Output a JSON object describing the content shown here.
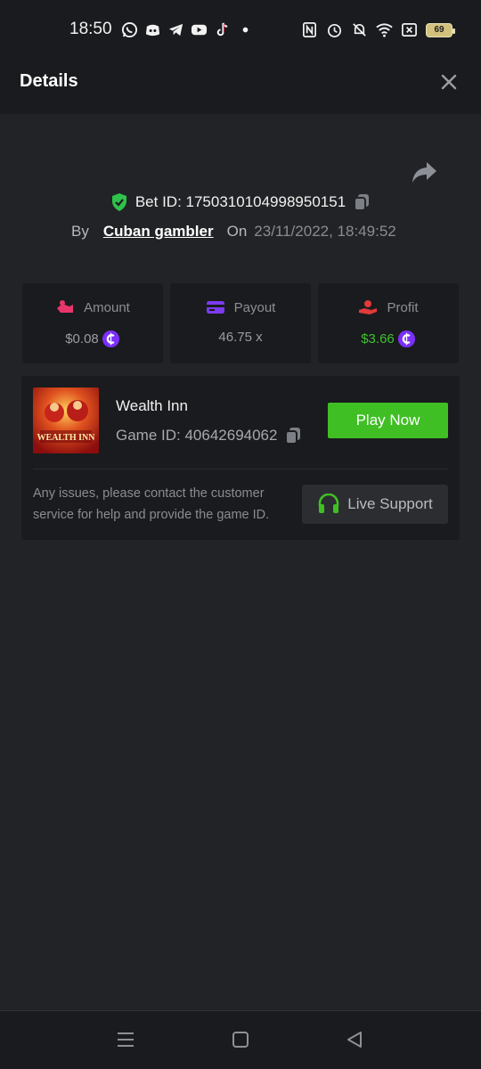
{
  "status_bar": {
    "time": "18:50",
    "notification_icons": [
      "whatsapp-icon",
      "discord-icon",
      "telegram-icon",
      "youtube-icon",
      "tiktok-icon",
      "dot-icon"
    ],
    "system_icons": [
      "nfc-icon",
      "alarm-icon",
      "mute-icon",
      "wifi-icon",
      "close-box-icon",
      "battery-icon"
    ],
    "battery": "69"
  },
  "header": {
    "title": "Details"
  },
  "bet": {
    "id_text": "Bet ID: 1750310104998950151",
    "by_label": "By",
    "user": "Cuban gambler",
    "on_label": "On",
    "date": "23/11/2022, 18:49:52"
  },
  "stats": {
    "amount_label": "Amount",
    "amount_value": "$0.08",
    "payout_label": "Payout",
    "payout_value": "46.75 x",
    "profit_label": "Profit",
    "profit_value": "$3.66"
  },
  "game": {
    "name": "Wealth Inn",
    "id_text": "Game ID: 40642694062",
    "thumb_text": "WEALTH INN",
    "play_label": "Play Now",
    "issue_text": "Any issues, please contact the customer service for help and provide the game ID.",
    "support_label": "Live Support"
  },
  "colors": {
    "accent_green": "#3fbf24",
    "profit_green": "#3ec22b",
    "coin_purple": "#7b2ff7",
    "shield_green": "#2ec24a"
  }
}
